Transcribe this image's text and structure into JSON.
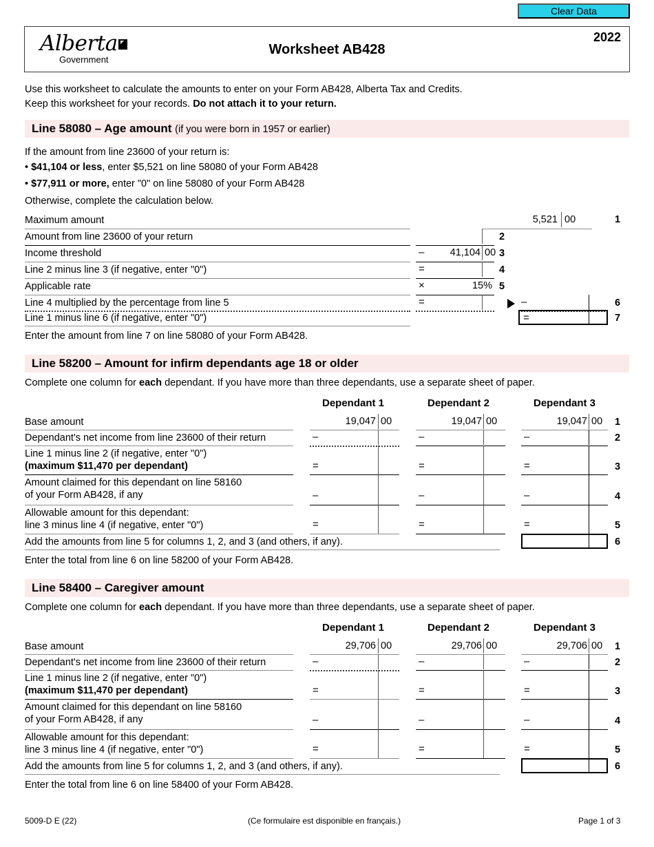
{
  "toolbar": {
    "clear_data_label": "Clear Data"
  },
  "header": {
    "logo_word": "Alberta",
    "logo_sub": "Government",
    "title": "Worksheet AB428",
    "year": "2022"
  },
  "intro": {
    "line1": "Use this worksheet to calculate the amounts to enter on your Form AB428, Alberta Tax and Credits.",
    "line2_a": "Keep this worksheet for your records. ",
    "line2_b": "Do not attach it to your return."
  },
  "section_58080": {
    "heading_main": "Line 58080 – Age amount ",
    "heading_sub": "(if you were born in 1957 or earlier)",
    "intro": "If the amount from line 23600 of your return is:",
    "bullet1_bold": "$41,104 or less",
    "bullet1_rest": ", enter $5,521 on line 58080 of your Form AB428",
    "bullet2_bold": "$77,911 or more,",
    "bullet2_rest": " enter \"0\" on line 58080 of your Form AB428",
    "otherwise": "Otherwise, complete the calculation below.",
    "rows": [
      {
        "no": "1",
        "label": "Maximum amount",
        "op": "",
        "dollars": "5,521",
        "cents": "00"
      },
      {
        "no": "2",
        "label": "Amount from line 23600 of your return",
        "op": "",
        "dollars": "",
        "cents": ""
      },
      {
        "no": "3",
        "label": "Income threshold",
        "op": "–",
        "dollars": "41,104",
        "cents": "00"
      },
      {
        "no": "4",
        "label": "Line 2 minus line 3 (if negative, enter \"0\")",
        "op": "=",
        "dollars": "",
        "cents": ""
      },
      {
        "no": "5",
        "label": "Applicable rate",
        "op": "×",
        "dollars": "15%",
        "cents": ""
      },
      {
        "no": "6",
        "label": "Line 4 multiplied by the percentage from line 5",
        "op": "=",
        "dollars": "",
        "cents": ""
      },
      {
        "no": "7",
        "label": "Line 1 minus line 6 (if negative, enter \"0\")",
        "op": "",
        "dollars": "",
        "cents": ""
      }
    ],
    "row6_right_op": "–",
    "row7_right_op": "=",
    "footer_note": "Enter the amount from line 7 on line 58080 of your Form AB428."
  },
  "section_58200": {
    "heading_main": "Line 58200 – Amount for infirm dependants age 18 or older",
    "intro_a": "Complete one column for ",
    "intro_b": "each",
    "intro_c": " dependant. If you have more than three dependants, use a separate sheet of paper.",
    "column_headers": [
      "Dependant 1",
      "Dependant 2",
      "Dependant 3"
    ],
    "base_amount": "19,047",
    "base_cents": "00",
    "rows": [
      {
        "no": "1",
        "label_1": "Base amount",
        "label_2": "",
        "op": ""
      },
      {
        "no": "2",
        "label_1": "Dependant's net income from line 23600 of their return",
        "label_2": "",
        "op": "–"
      },
      {
        "no": "3",
        "label_1": "Line 1 minus line 2 (if negative, enter \"0\")",
        "label_2": "(maximum $11,470 per dependant)",
        "op": "="
      },
      {
        "no": "4",
        "label_1": "Amount claimed for this dependant on line 58160",
        "label_2": "of your Form AB428, if any",
        "op": "–"
      },
      {
        "no": "5",
        "label_1": "Allowable amount for this dependant:",
        "label_2": "line 3 minus line 4 (if negative, enter \"0\")",
        "op": "="
      },
      {
        "no": "6",
        "label_1": "Add the amounts from line 5 for columns 1, 2, and 3 (and others, if any).",
        "label_2": "",
        "op": ""
      }
    ],
    "footer_note": "Enter the total from line 6 on line 58200 of your Form AB428."
  },
  "section_58400": {
    "heading_main": "Line 58400 – Caregiver amount",
    "intro_a": "Complete one column for ",
    "intro_b": "each",
    "intro_c": " dependant. If you have more than three dependants, use a separate sheet of paper.",
    "column_headers": [
      "Dependant 1",
      "Dependant 2",
      "Dependant 3"
    ],
    "base_amount": "29,706",
    "base_cents": "00",
    "rows": [
      {
        "no": "1",
        "label_1": "Base amount",
        "label_2": "",
        "op": ""
      },
      {
        "no": "2",
        "label_1": "Dependant's net income from line 23600 of their return",
        "label_2": "",
        "op": "–"
      },
      {
        "no": "3",
        "label_1": "Line 1 minus line 2 (if negative, enter \"0\")",
        "label_2": "(maximum $11,470 per dependant)",
        "op": "="
      },
      {
        "no": "4",
        "label_1": "Amount claimed for this dependant on line 58160",
        "label_2": "of your Form AB428, if any",
        "op": "–"
      },
      {
        "no": "5",
        "label_1": "Allowable amount for this dependant:",
        "label_2": "line 3 minus line 4 (if negative, enter \"0\")",
        "op": "="
      },
      {
        "no": "6",
        "label_1": "Add the amounts from line 5 for columns 1, 2, and 3 (and others, if any).",
        "label_2": "",
        "op": ""
      }
    ],
    "footer_note": "Enter the total from line 6 on line 58400 of your Form AB428."
  },
  "footer": {
    "form_code": "5009-D E (22)",
    "french_note": "(Ce formulaire est disponible en français.)",
    "page_label": "Page 1 of 3"
  },
  "colors": {
    "section_header_bg": "#fbeaea",
    "clear_button_bg": "#28d1e8"
  }
}
